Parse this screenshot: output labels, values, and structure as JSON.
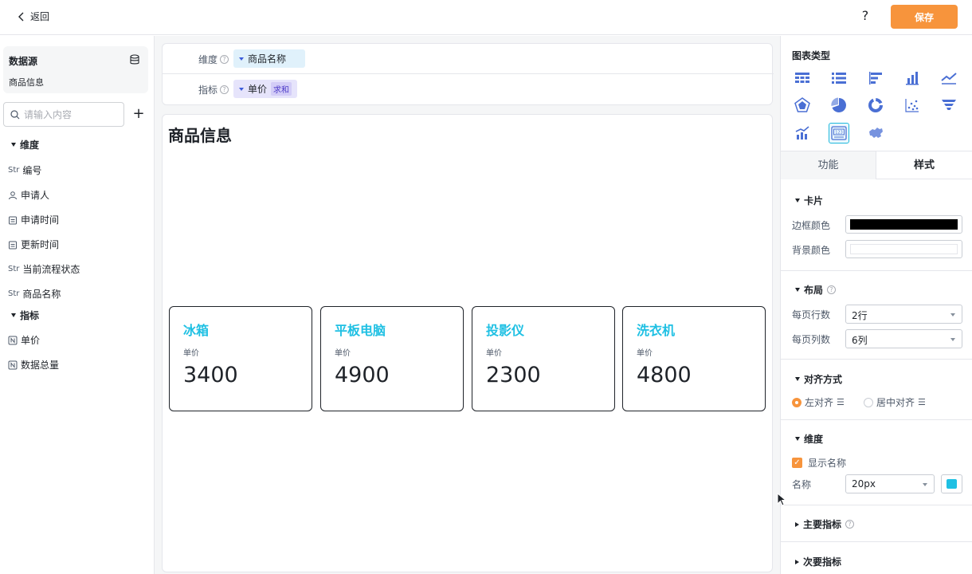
{
  "topbar": {
    "back_label": "返回",
    "help_label": "?",
    "save_label": "保存"
  },
  "left": {
    "datasource_title": "数据源",
    "datasource_name": "商品信息",
    "search_placeholder": "请输入内容",
    "plus_label": "+",
    "dimension_section": "维度",
    "dimensions": [
      {
        "type": "Str",
        "label": "编号"
      },
      {
        "type": "user",
        "label": "申请人"
      },
      {
        "type": "date",
        "label": "申请时间"
      },
      {
        "type": "date",
        "label": "更新时间"
      },
      {
        "type": "Str",
        "label": "当前流程状态"
      },
      {
        "type": "Str",
        "label": "商品名称"
      }
    ],
    "metric_section": "指标",
    "metrics": [
      {
        "type": "N",
        "label": "单价"
      },
      {
        "type": "N",
        "label": "数据总量"
      }
    ]
  },
  "config": {
    "dimension_label": "维度",
    "dimension_value": "商品名称",
    "metric_label": "指标",
    "metric_value": "单价",
    "metric_agg": "求和"
  },
  "chart": {
    "title": "商品信息",
    "metric_label": "单价",
    "cards": [
      {
        "name": "冰箱",
        "value": "3400"
      },
      {
        "name": "平板电脑",
        "value": "4900"
      },
      {
        "name": "投影仪",
        "value": "2300"
      },
      {
        "name": "洗衣机",
        "value": "4800"
      }
    ]
  },
  "right": {
    "chart_type_title": "图表类型",
    "chart_types": [
      "table-icon",
      "list-icon",
      "horizontal-bar-icon",
      "bar-icon",
      "line-icon",
      "radar-icon",
      "pie-icon",
      "donut-icon",
      "scatter-icon",
      "funnel-icon",
      "combo-icon",
      "kpi-card-icon",
      "map-icon"
    ],
    "selected_chart_type": "kpi-card-icon",
    "tab_function": "功能",
    "tab_style": "样式",
    "card_section": "卡片",
    "border_color_label": "边框颜色",
    "border_color": "#000000",
    "bg_color_label": "背景颜色",
    "bg_color": "#ffffff",
    "layout_section": "布局",
    "rows_label": "每页行数",
    "rows_value": "2行",
    "cols_label": "每页列数",
    "cols_value": "6列",
    "align_section": "对齐方式",
    "align_left": "左对齐",
    "align_center": "居中对齐",
    "dim_section": "维度",
    "show_name_label": "显示名称",
    "name_label": "名称",
    "name_size": "20px",
    "name_color": "#1fc0e3",
    "primary_metric_section": "主要指标",
    "secondary_metric_section": "次要指标"
  },
  "colors": {
    "accent": "#f7943c",
    "name_cyan": "#1fc0e3",
    "chart_icon": "#4a6fd4"
  }
}
